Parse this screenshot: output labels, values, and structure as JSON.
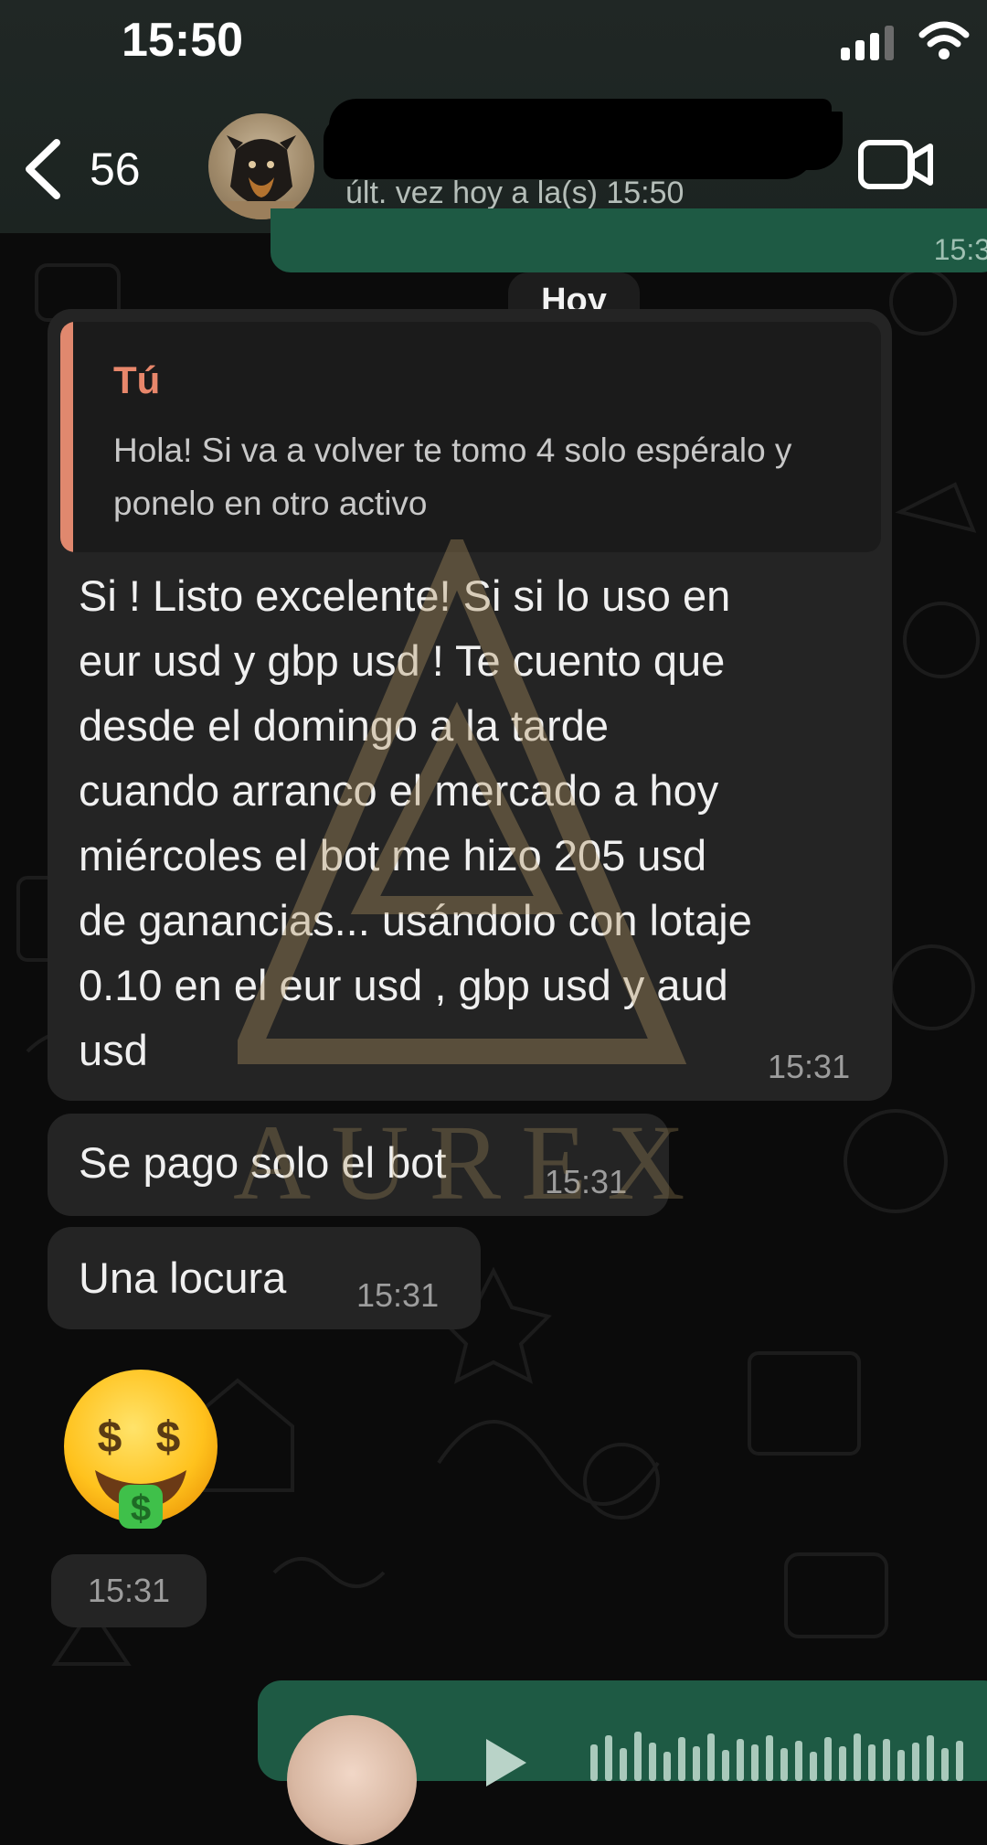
{
  "status_bar": {
    "time": "15:50"
  },
  "header": {
    "back_count": "56",
    "last_seen": "últ. vez hoy a la(s) 15:50",
    "prev_bubble_time": "15:3"
  },
  "day_label": "Hoy",
  "messages": [
    {
      "quote_author": "Tú",
      "quote_text": "Hola! Si va a volver te tomo 4 solo espéralo y ponelo en otro activo",
      "text": "Si ! Listo excelente! Si si lo uso en\neur usd y gbp usd ! Te cuento que\ndesde el domingo a la tarde\ncuando arranco el mercado a hoy\nmiércoles el bot me hizo 205 usd\nde ganancias... usándolo con lotaje\n0.10 en el eur usd , gbp usd y aud\nusd",
      "time": "15:31"
    },
    {
      "text": "Se pago solo el bot",
      "time": "15:31"
    },
    {
      "text": "Una locura",
      "time": "15:31"
    },
    {
      "emoji": "money-mouth-face",
      "time": "15:31"
    }
  ],
  "watermark": {
    "text": "AUREX"
  },
  "colors": {
    "header_bg": "#1f2724",
    "incoming_bubble": "#242424",
    "outgoing_bubble": "#1e5a44",
    "quote_accent": "#e8876b"
  },
  "icons": [
    "back-chevron-icon",
    "signal-icon",
    "wifi-icon",
    "video-call-icon",
    "play-icon"
  ]
}
